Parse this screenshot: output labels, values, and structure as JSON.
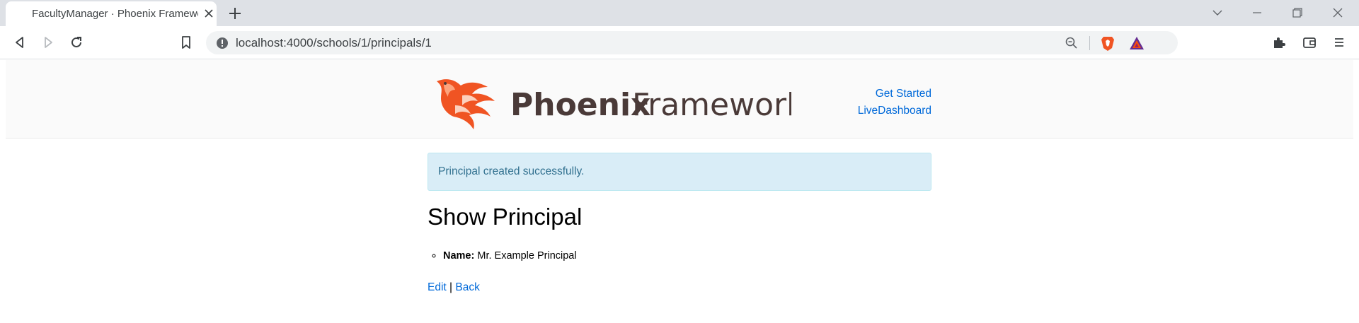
{
  "browser": {
    "tab_title": "FacultyManager · Phoenix Framework",
    "url": "localhost:4000/schools/1/principals/1"
  },
  "header": {
    "brand_bold": "Phoenix",
    "brand_light": "Framework",
    "nav": [
      {
        "label": "Get Started"
      },
      {
        "label": "LiveDashboard"
      }
    ]
  },
  "flash": {
    "message": "Principal created successfully."
  },
  "main": {
    "title": "Show Principal",
    "fields": [
      {
        "label": "Name:",
        "value": "Mr. Example Principal"
      }
    ],
    "actions": {
      "edit": "Edit",
      "separator": "|",
      "back": "Back"
    }
  },
  "colors": {
    "brand_orange": "#f05423",
    "brand_text": "#4a3a38",
    "link": "#0069d9",
    "alert_bg": "#d9edf7",
    "alert_text": "#31708f"
  },
  "icons": {
    "tab_close": "close-icon",
    "new_tab": "plus-icon",
    "back": "back-arrow-icon",
    "forward": "forward-arrow-icon",
    "reload": "reload-icon",
    "bookmark": "bookmark-icon",
    "site_info": "info-icon",
    "zoom": "zoom-out-icon",
    "brave": "brave-shield-icon",
    "rewards": "bat-rewards-icon",
    "extensions": "puzzle-icon",
    "wallet": "wallet-icon",
    "menu": "hamburger-menu-icon",
    "logo": "phoenix-bird-icon"
  }
}
